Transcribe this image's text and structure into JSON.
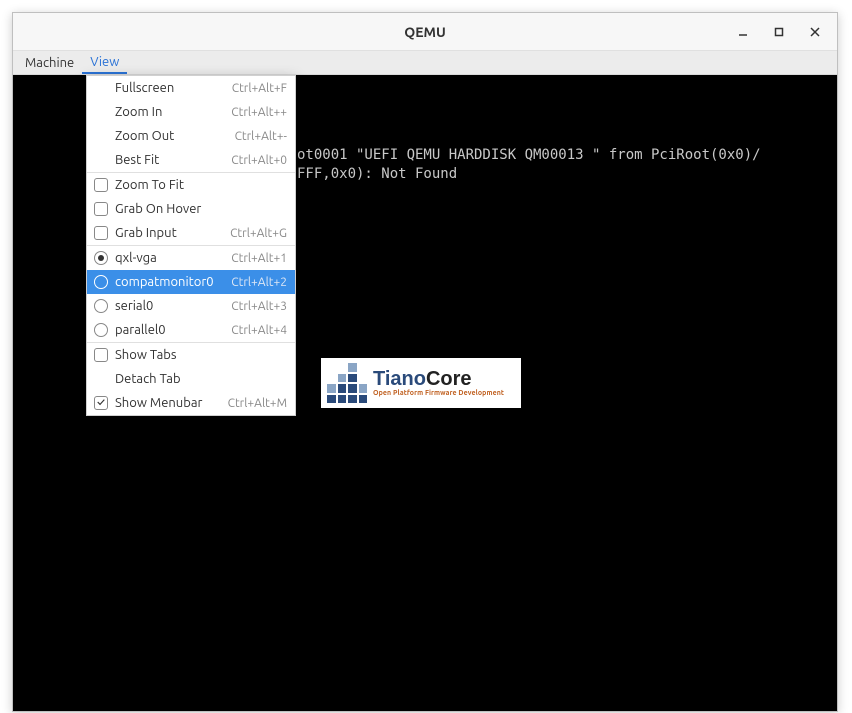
{
  "window": {
    "title": "QEMU"
  },
  "menubar": {
    "items": [
      {
        "label": "Machine"
      },
      {
        "label": "View"
      }
    ],
    "active_index": 1
  },
  "view_menu": {
    "items": [
      {
        "type": "plain",
        "label": "Fullscreen",
        "shortcut": "Ctrl+Alt+F"
      },
      {
        "type": "plain",
        "label": "Zoom In",
        "shortcut": "Ctrl+Alt++"
      },
      {
        "type": "plain",
        "label": "Zoom Out",
        "shortcut": "Ctrl+Alt+-"
      },
      {
        "type": "plain",
        "label": "Best Fit",
        "shortcut": "Ctrl+Alt+0"
      },
      {
        "type": "checkbox",
        "label": "Zoom To Fit",
        "checked": false
      },
      {
        "type": "checkbox",
        "label": "Grab On Hover",
        "checked": false
      },
      {
        "type": "checkbox",
        "label": "Grab Input",
        "checked": false,
        "shortcut": "Ctrl+Alt+G"
      },
      {
        "type": "radio",
        "label": "qxl-vga",
        "checked": true,
        "shortcut": "Ctrl+Alt+1"
      },
      {
        "type": "radio",
        "label": "compatmonitor0",
        "checked": false,
        "shortcut": "Ctrl+Alt+2",
        "selected": true
      },
      {
        "type": "radio",
        "label": "serial0",
        "checked": false,
        "shortcut": "Ctrl+Alt+3"
      },
      {
        "type": "radio",
        "label": "parallel0",
        "checked": false,
        "shortcut": "Ctrl+Alt+4"
      },
      {
        "type": "checkbox",
        "label": "Show Tabs",
        "checked": false
      },
      {
        "type": "plain",
        "label": "Detach Tab"
      },
      {
        "type": "checkbox",
        "label": "Show Menubar",
        "checked": true,
        "shortcut": "Ctrl+Alt+M"
      }
    ],
    "separators_after": [
      3,
      6,
      10
    ]
  },
  "terminal": {
    "line1": "ot0001 \"UEFI QEMU HARDDISK QM00013 \" from PciRoot(0x0)/",
    "line2": "FFF,0x0): Not Found"
  },
  "logo": {
    "name_left": "Tiano",
    "name_right": "Core",
    "subtitle": "Open Platform Firmware Development"
  }
}
